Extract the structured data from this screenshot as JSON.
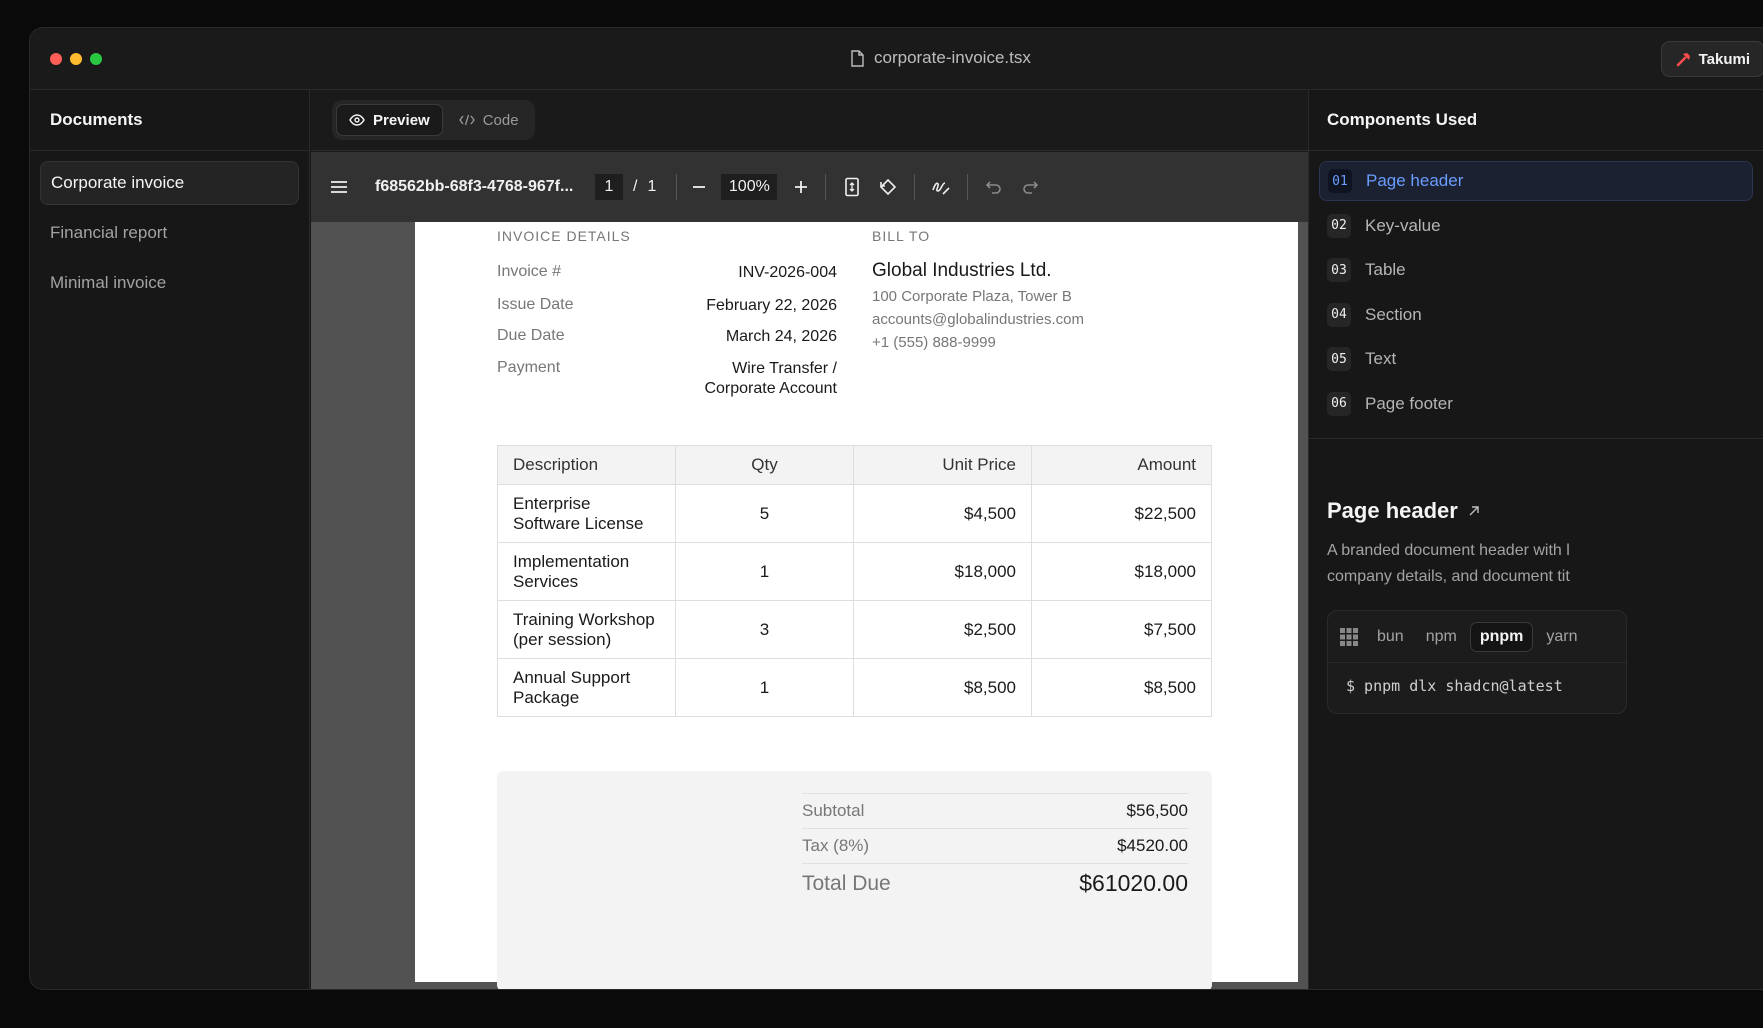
{
  "window": {
    "file_title": "corporate-invoice.tsx",
    "takumi_label": "Takumi",
    "dot_colors": [
      "#ff5f57",
      "#febc2e",
      "#28c840"
    ]
  },
  "documents": {
    "heading": "Documents",
    "items": [
      {
        "label": "Corporate invoice",
        "active": true
      },
      {
        "label": "Financial report",
        "active": false
      },
      {
        "label": "Minimal invoice",
        "active": false
      }
    ]
  },
  "view_toggle": {
    "preview": "Preview",
    "code": "Code"
  },
  "pdf_toolbar": {
    "file_name": "f68562bb-68f3-4768-967f...",
    "page_current": "1",
    "page_sep": "/",
    "page_total": "1",
    "zoom": "100%"
  },
  "invoice": {
    "details_label": "INVOICE DETAILS",
    "bill_to_label": "BILL TO",
    "details": [
      {
        "k": "Invoice #",
        "v": "INV-2026-004"
      },
      {
        "k": "Issue Date",
        "v": "February 22, 2026"
      },
      {
        "k": "Due Date",
        "v": "March 24, 2026"
      },
      {
        "k": "Payment",
        "v1": "Wire Transfer /",
        "v2": "Corporate Account"
      }
    ],
    "bill_to": {
      "name": "Global Industries Ltd.",
      "address": "100 Corporate Plaza, Tower B",
      "email": "accounts@globalindustries.com",
      "phone": "+1 (555) 888-9999"
    },
    "table": {
      "headers": [
        "Description",
        "Qty",
        "Unit Price",
        "Amount"
      ],
      "rows": [
        {
          "d1": "Enterprise",
          "d2": "Software License",
          "qty": "5",
          "unit": "$4,500",
          "amount": "$22,500"
        },
        {
          "d1": "Implementation",
          "d2": "Services",
          "qty": "1",
          "unit": "$18,000",
          "amount": "$18,000"
        },
        {
          "d1": "Training Workshop",
          "d2": "(per session)",
          "qty": "3",
          "unit": "$2,500",
          "amount": "$7,500"
        },
        {
          "d1": "Annual Support",
          "d2": "Package",
          "qty": "1",
          "unit": "$8,500",
          "amount": "$8,500"
        }
      ]
    },
    "totals": {
      "subtotal_label": "Subtotal",
      "subtotal": "$56,500",
      "tax_label": "Tax (8%)",
      "tax": "$4520.00",
      "total_label": "Total Due",
      "total": "$61020.00"
    }
  },
  "components": {
    "heading": "Components Used",
    "items": [
      {
        "num": "01",
        "label": "Page header",
        "active": true
      },
      {
        "num": "02",
        "label": "Key-value",
        "active": false
      },
      {
        "num": "03",
        "label": "Table",
        "active": false
      },
      {
        "num": "04",
        "label": "Section",
        "active": false
      },
      {
        "num": "05",
        "label": "Text",
        "active": false
      },
      {
        "num": "06",
        "label": "Page footer",
        "active": false
      }
    ],
    "detail": {
      "title": "Page header",
      "desc1": "A branded document header with l",
      "desc2": "company details, and document tit"
    },
    "install": {
      "managers": [
        "bun",
        "npm",
        "pnpm",
        "yarn"
      ],
      "active_manager": "pnpm",
      "command": "$ pnpm dlx shadcn@latest"
    }
  }
}
